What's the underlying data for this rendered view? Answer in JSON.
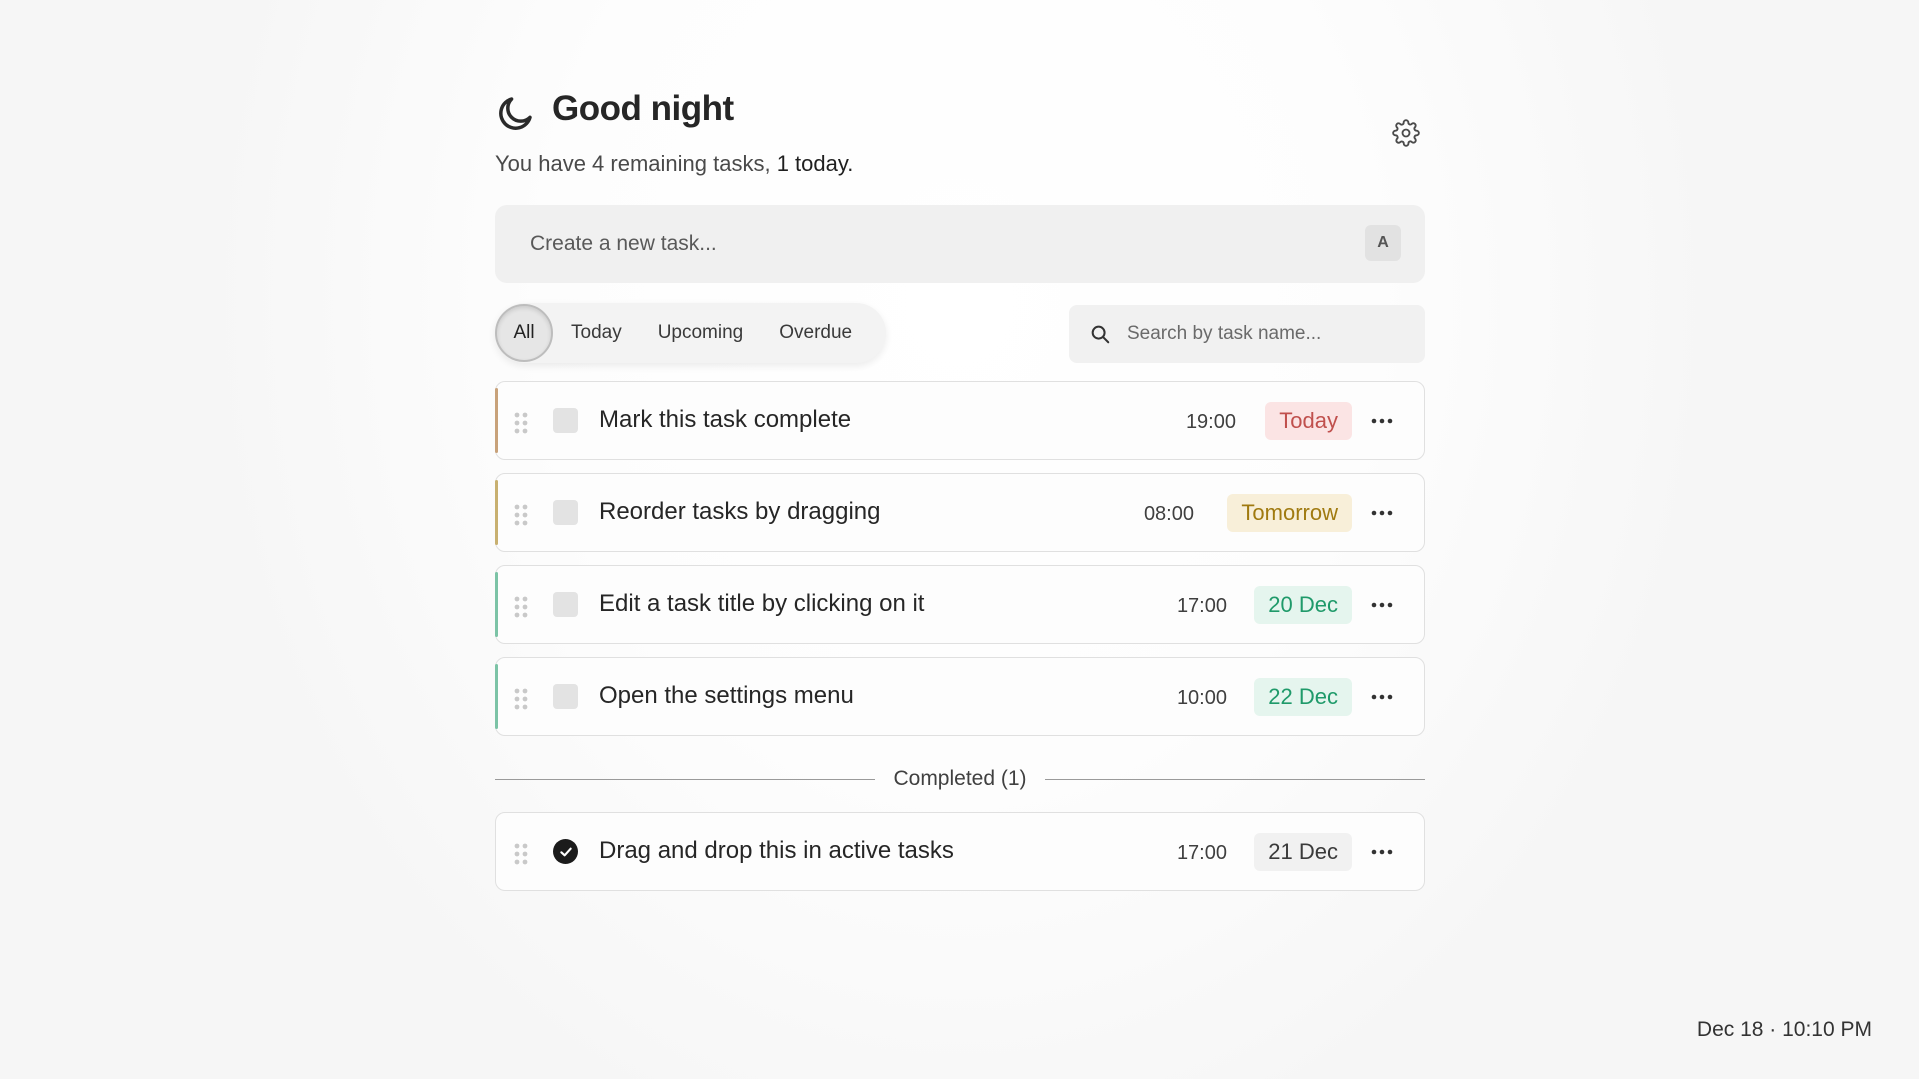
{
  "header": {
    "greeting": "Good night",
    "summary_prefix": "You have 4 remaining tasks, ",
    "summary_today": "1 today."
  },
  "create": {
    "placeholder": "Create a new task...",
    "shortcut": "A"
  },
  "filters": {
    "tabs": [
      {
        "label": "All",
        "active": true
      },
      {
        "label": "Today",
        "active": false
      },
      {
        "label": "Upcoming",
        "active": false
      },
      {
        "label": "Overdue",
        "active": false
      }
    ]
  },
  "search": {
    "placeholder": "Search by task name..."
  },
  "tasks": [
    {
      "title": "Mark this task complete",
      "time": "19:00",
      "due": "Today",
      "due_color": "#c0504d",
      "due_bg": "#fbe4e4",
      "accent": "#c8a27a",
      "done": false
    },
    {
      "title": "Reorder tasks by dragging",
      "time": "08:00",
      "due": "Tomorrow",
      "due_color": "#a07a10",
      "due_bg": "#f8efd9",
      "accent": "#c8b070",
      "done": false
    },
    {
      "title": "Edit a task title by clicking on it",
      "time": "17:00",
      "due": "20 Dec",
      "due_color": "#1f9a6a",
      "due_bg": "#e5f5ee",
      "accent": "#7cc3a6",
      "done": false
    },
    {
      "title": "Open the settings menu",
      "time": "10:00",
      "due": "22 Dec",
      "due_color": "#1f9a6a",
      "due_bg": "#e5f5ee",
      "accent": "#7cc3a6",
      "done": false
    }
  ],
  "completed": {
    "label": "Completed (1)",
    "tasks": [
      {
        "title": "Drag and drop this in active tasks",
        "time": "17:00",
        "due": "21 Dec",
        "due_color": "#3a3a3a",
        "due_bg": "#f1f1f1",
        "done": true
      }
    ]
  },
  "footer": {
    "datetime": "Dec 18 · 10:10 PM"
  },
  "icons": {
    "header": "moon-icon",
    "settings": "gear-icon",
    "search": "search-icon",
    "drag": "drag-handle-icon",
    "more": "more-horizontal-icon",
    "done": "check-circle-icon"
  }
}
